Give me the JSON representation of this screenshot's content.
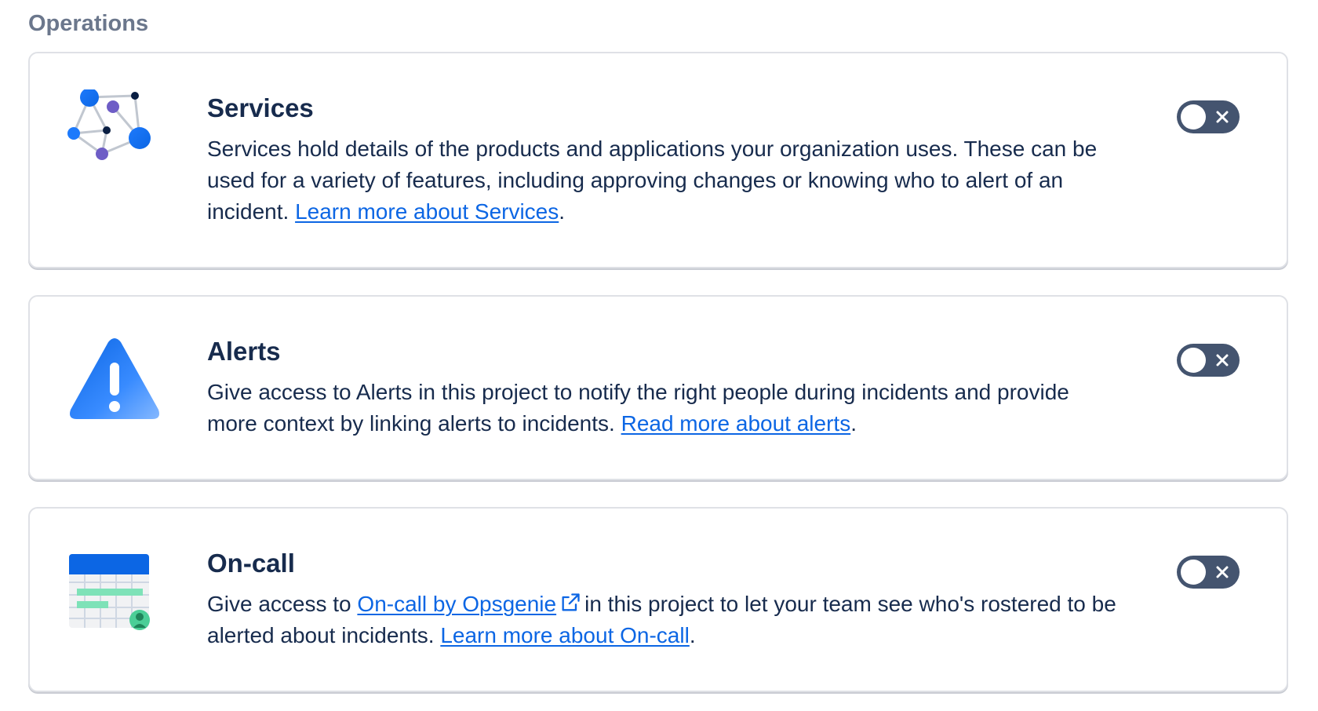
{
  "section": {
    "title": "Operations"
  },
  "cards": [
    {
      "id": "services",
      "icon": "network-nodes-icon",
      "title": "Services",
      "desc_before": "Services hold details of the products and applications your organization uses. These can be used for a variety of features, including approving changes or knowing who to alert of an incident.",
      "link_label": "Learn more about Services",
      "desc_after": ".",
      "toggle": {
        "enabled": false
      }
    },
    {
      "id": "alerts",
      "icon": "alert-triangle-icon",
      "title": "Alerts",
      "desc_before": "Give access to Alerts in this project to notify the right people during incidents and provide more context by linking alerts to incidents.",
      "link_label": "Read more about alerts",
      "desc_after": ".",
      "toggle": {
        "enabled": false
      }
    },
    {
      "id": "oncall",
      "icon": "calendar-icon",
      "title": "On-call",
      "desc_before": "Give access to",
      "inline_link_label": "On-call by Opsgenie",
      "desc_middle": "in this project to let your team see who's rostered to be alerted about incidents.",
      "link_label": "Learn more about On-call",
      "desc_after": ".",
      "toggle": {
        "enabled": false
      }
    }
  ],
  "colors": {
    "link": "#0c66e4",
    "toggle_off": "#44546f",
    "heading": "#172b4d",
    "section_title": "#6b778c"
  }
}
